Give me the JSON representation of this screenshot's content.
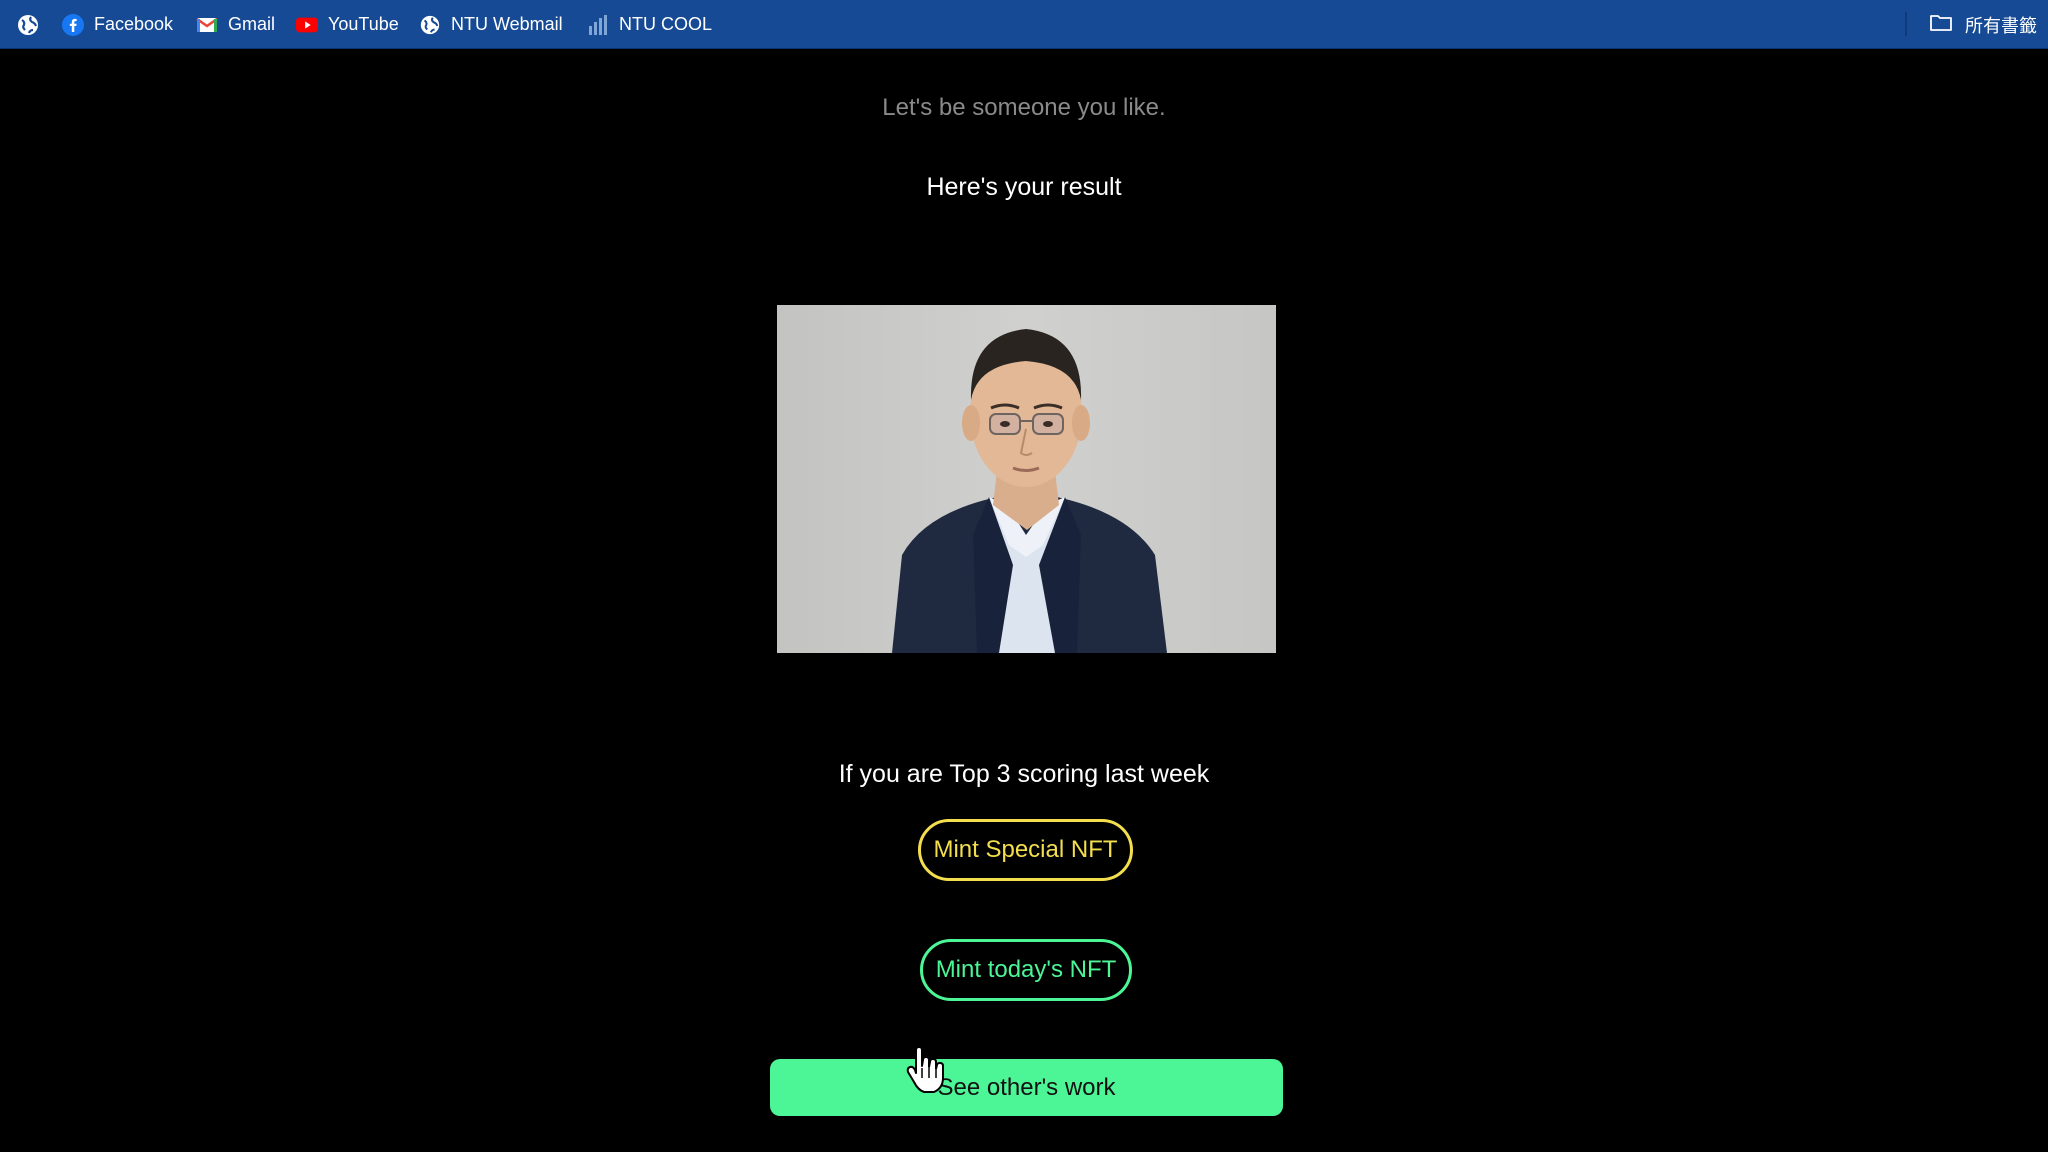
{
  "bookmarks": {
    "items": [
      {
        "label": "Facebook",
        "icon": "facebook-icon"
      },
      {
        "label": "Gmail",
        "icon": "gmail-icon"
      },
      {
        "label": "YouTube",
        "icon": "youtube-icon"
      },
      {
        "label": "NTU Webmail",
        "icon": "globe-icon"
      },
      {
        "label": "NTU COOL",
        "icon": "bar-chart-icon"
      }
    ],
    "all_bookmarks_label": "所有書籤"
  },
  "page": {
    "tagline": "Let's be someone you like.",
    "result_heading": "Here's your result",
    "top3_text": "If you are Top 3 scoring last week",
    "mint_special_label": "Mint Special NFT",
    "mint_today_label": "Mint today's NFT",
    "see_others_label": "See other's work"
  },
  "colors": {
    "bookmarks_bar": "#164a94",
    "background": "#000000",
    "special_accent": "#f3df4d",
    "today_accent": "#4cf596",
    "see_button": "#4cf596"
  }
}
